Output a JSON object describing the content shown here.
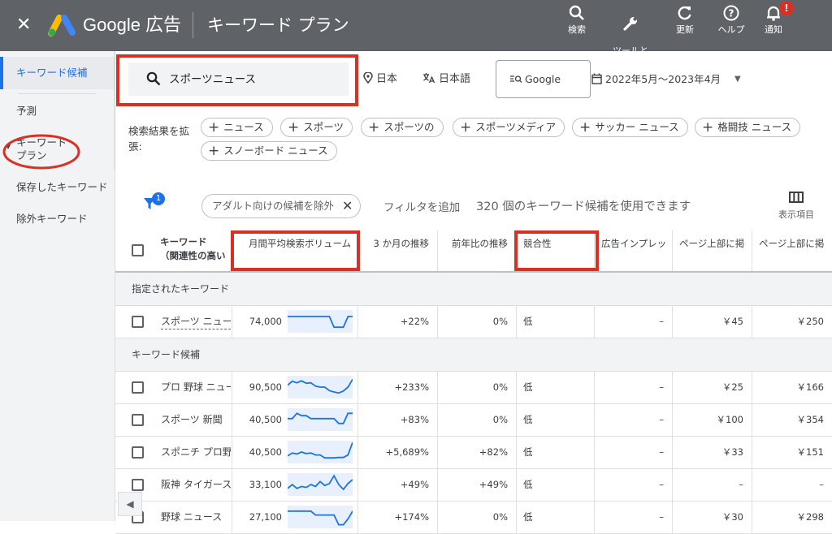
{
  "header": {
    "close_icon": "✕",
    "brand": "Google 広告",
    "page_title": "キーワード プラン",
    "tools": [
      {
        "label": "検索",
        "icon": "search-icon"
      },
      {
        "label": "ツールと\n設定",
        "icon": "wrench-icon"
      },
      {
        "label": "更新",
        "icon": "refresh-icon"
      },
      {
        "label": "ヘルプ",
        "icon": "help-icon"
      },
      {
        "label": "通知",
        "icon": "bell-icon",
        "badge": "!"
      }
    ]
  },
  "sidebar": {
    "items": [
      {
        "label": "キーワード候補",
        "active": true
      },
      {
        "label": "予測"
      },
      {
        "label": "キーワード\nプラン"
      },
      {
        "label": "保存したキーワード"
      },
      {
        "label": "除外キーワード"
      }
    ]
  },
  "search": {
    "value": "スポーツニュース",
    "location": "日本",
    "language": "日本語",
    "network": "Google",
    "date_range": "2022年5月〜2023年4月"
  },
  "expand": {
    "label": "検索結果を拡張:",
    "chips": [
      "ニュース",
      "スポーツ",
      "スポーツの",
      "スポーツメディア",
      "サッカー ニュース",
      "格闘技 ニュース",
      "スノーボード ニュース"
    ]
  },
  "filterbar": {
    "filter_count": "1",
    "adult_chip": "アダルト向けの候補を除外",
    "add_filter": "フィルタを追加",
    "count_text": "320 個のキーワード候補を使用できます",
    "columns_label": "表示項目"
  },
  "table": {
    "headers": {
      "keyword": "キーワード\n（関連性の高い",
      "volume": "月間平均検索ボリューム",
      "three_month": "3 か月の推移",
      "yoy": "前年比の推移",
      "competition": "競合性",
      "impression": "広告インプレッ",
      "top_low": "ページ上部に掲",
      "top_high": "ページ上部に掲"
    },
    "section_specified": "指定されたキーワード",
    "section_ideas": "キーワード候補",
    "specified_rows": [
      {
        "keyword": "スポーツ ニュース",
        "volume": "74,000",
        "three_month": "+22%",
        "yoy": "0%",
        "competition": "低",
        "impression": "–",
        "top_low": "￥45",
        "top_high": "￥250",
        "trend": [
          0.75,
          0.75,
          0.75,
          0.75,
          0.75,
          0.75,
          0.75,
          0.75,
          0.75,
          0.75,
          0.2,
          0.2,
          0.2,
          0.75,
          0.75
        ]
      }
    ],
    "idea_rows": [
      {
        "keyword": "プロ 野球 ニュース",
        "volume": "90,500",
        "three_month": "+233%",
        "yoy": "0%",
        "competition": "低",
        "impression": "–",
        "top_low": "￥25",
        "top_high": "￥166",
        "trend": [
          0.6,
          0.8,
          0.72,
          0.82,
          0.7,
          0.72,
          0.55,
          0.5,
          0.5,
          0.32,
          0.25,
          0.2,
          0.3,
          0.5,
          0.9
        ]
      },
      {
        "keyword": "スポーツ 新聞",
        "volume": "40,500",
        "three_month": "+83%",
        "yoy": "0%",
        "competition": "低",
        "impression": "–",
        "top_low": "￥100",
        "top_high": "￥354",
        "trend": [
          0.55,
          0.55,
          0.82,
          0.7,
          0.7,
          0.55,
          0.55,
          0.55,
          0.55,
          0.55,
          0.55,
          0.3,
          0.3,
          0.82,
          0.82
        ]
      },
      {
        "keyword": "スポニチ プロ野球",
        "volume": "40,500",
        "three_month": "+5,689%",
        "yoy": "+82%",
        "competition": "低",
        "impression": "–",
        "top_low": "￥33",
        "top_high": "￥151",
        "trend": [
          0.3,
          0.45,
          0.4,
          0.5,
          0.42,
          0.45,
          0.35,
          0.35,
          0.2,
          0.2,
          0.2,
          0.22,
          0.22,
          0.35,
          1.0
        ]
      },
      {
        "keyword": "阪神 タイガース ニュース",
        "volume": "33,100",
        "three_month": "+49%",
        "yoy": "+49%",
        "competition": "低",
        "impression": "–",
        "top_low": "–",
        "top_high": "–",
        "trend": [
          0.3,
          0.5,
          0.3,
          0.4,
          0.35,
          0.5,
          0.4,
          0.65,
          0.45,
          0.55,
          0.95,
          0.5,
          0.25,
          0.55,
          0.75
        ]
      },
      {
        "keyword": "野球 ニュース",
        "volume": "27,100",
        "three_month": "+174%",
        "yoy": "0%",
        "competition": "低",
        "impression": "–",
        "top_low": "￥30",
        "top_high": "￥298",
        "trend": [
          0.8,
          0.8,
          0.8,
          0.8,
          0.8,
          0.8,
          0.6,
          0.6,
          0.6,
          0.6,
          0.6,
          0.1,
          0.1,
          0.4,
          0.8
        ]
      }
    ]
  },
  "colors": {
    "topbar": "#5f6368",
    "accent": "#1a73e8",
    "annotation": "#d93025",
    "spark_line": "#1a73e8",
    "spark_bg": "#e8f0fe"
  }
}
